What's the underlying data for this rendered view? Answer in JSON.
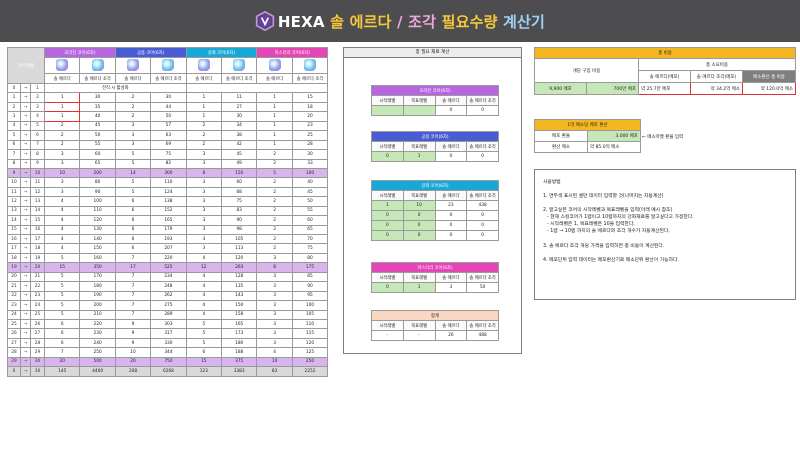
{
  "header": {
    "brand": "HEXA",
    "t1": "솔 에르다",
    "t2": "/",
    "t3": "조각",
    "t4": "필요수량",
    "t5": "계산기"
  },
  "main": {
    "level_header": "코어레벨",
    "cores": [
      {
        "name": "오리진 코어(6차)",
        "color": "#b866e0"
      },
      {
        "name": "공용 코어(6차)",
        "color": "#4a5bd6"
      },
      {
        "name": "강화 코어(6차)",
        "color": "#17a8d8"
      },
      {
        "name": "마스터리 코어(6차)",
        "color": "#e546b5"
      }
    ],
    "sub_erda": "솔 에르다",
    "sub_piece": "솔 에르다 조각",
    "row0_note": "전직 시 활성화",
    "rows": [
      {
        "a": "0",
        "b": "1",
        "v": []
      },
      {
        "a": "1",
        "b": "2",
        "v": [
          "1",
          "30",
          "2",
          "30",
          "1",
          "11",
          "1",
          "15"
        ]
      },
      {
        "a": "2",
        "b": "3",
        "v": [
          "1",
          "35",
          "2",
          "44",
          "1",
          "27",
          "1",
          "18"
        ]
      },
      {
        "a": "3",
        "b": "4",
        "v": [
          "1",
          "40",
          "2",
          "50",
          "1",
          "30",
          "1",
          "20"
        ]
      },
      {
        "a": "4",
        "b": "5",
        "v": [
          "2",
          "45",
          "3",
          "57",
          "2",
          "34",
          "1",
          "23"
        ]
      },
      {
        "a": "5",
        "b": "6",
        "v": [
          "2",
          "50",
          "3",
          "63",
          "2",
          "38",
          "1",
          "25"
        ]
      },
      {
        "a": "6",
        "b": "7",
        "v": [
          "2",
          "55",
          "3",
          "69",
          "2",
          "42",
          "1",
          "28"
        ]
      },
      {
        "a": "7",
        "b": "8",
        "v": [
          "3",
          "60",
          "5",
          "75",
          "3",
          "45",
          "2",
          "30"
        ]
      },
      {
        "a": "8",
        "b": "9",
        "v": [
          "3",
          "65",
          "5",
          "82",
          "3",
          "49",
          "2",
          "33"
        ]
      },
      {
        "a": "9",
        "b": "10",
        "v": [
          "10",
          "200",
          "14",
          "300",
          "8",
          "150",
          "5",
          "100"
        ]
      },
      {
        "a": "10",
        "b": "11",
        "v": [
          "3",
          "80",
          "5",
          "110",
          "3",
          "60",
          "2",
          "40"
        ]
      },
      {
        "a": "11",
        "b": "12",
        "v": [
          "3",
          "90",
          "5",
          "124",
          "3",
          "68",
          "2",
          "45"
        ]
      },
      {
        "a": "12",
        "b": "13",
        "v": [
          "4",
          "100",
          "6",
          "138",
          "3",
          "75",
          "2",
          "50"
        ]
      },
      {
        "a": "13",
        "b": "14",
        "v": [
          "4",
          "110",
          "6",
          "152",
          "3",
          "83",
          "2",
          "55"
        ]
      },
      {
        "a": "14",
        "b": "15",
        "v": [
          "4",
          "120",
          "6",
          "165",
          "3",
          "90",
          "2",
          "60"
        ]
      },
      {
        "a": "15",
        "b": "16",
        "v": [
          "4",
          "130",
          "6",
          "179",
          "3",
          "98",
          "2",
          "65"
        ]
      },
      {
        "a": "16",
        "b": "17",
        "v": [
          "4",
          "140",
          "6",
          "193",
          "3",
          "105",
          "2",
          "70"
        ]
      },
      {
        "a": "17",
        "b": "18",
        "v": [
          "4",
          "150",
          "6",
          "207",
          "3",
          "113",
          "2",
          "75"
        ]
      },
      {
        "a": "18",
        "b": "19",
        "v": [
          "5",
          "160",
          "7",
          "220",
          "4",
          "120",
          "3",
          "80"
        ]
      },
      {
        "a": "19",
        "b": "20",
        "v": [
          "15",
          "350",
          "17",
          "525",
          "12",
          "263",
          "8",
          "175"
        ]
      },
      {
        "a": "20",
        "b": "21",
        "v": [
          "5",
          "170",
          "7",
          "234",
          "4",
          "128",
          "3",
          "85"
        ]
      },
      {
        "a": "21",
        "b": "22",
        "v": [
          "5",
          "180",
          "7",
          "248",
          "4",
          "135",
          "3",
          "90"
        ]
      },
      {
        "a": "22",
        "b": "23",
        "v": [
          "5",
          "190",
          "7",
          "262",
          "4",
          "143",
          "3",
          "95"
        ]
      },
      {
        "a": "23",
        "b": "24",
        "v": [
          "5",
          "200",
          "7",
          "275",
          "4",
          "150",
          "3",
          "100"
        ]
      },
      {
        "a": "24",
        "b": "25",
        "v": [
          "5",
          "210",
          "7",
          "289",
          "4",
          "158",
          "3",
          "105"
        ]
      },
      {
        "a": "25",
        "b": "26",
        "v": [
          "6",
          "220",
          "9",
          "303",
          "5",
          "165",
          "3",
          "110"
        ]
      },
      {
        "a": "26",
        "b": "27",
        "v": [
          "6",
          "230",
          "9",
          "317",
          "5",
          "173",
          "3",
          "115"
        ]
      },
      {
        "a": "27",
        "b": "28",
        "v": [
          "6",
          "240",
          "9",
          "330",
          "5",
          "180",
          "3",
          "120"
        ]
      },
      {
        "a": "28",
        "b": "29",
        "v": [
          "7",
          "250",
          "10",
          "344",
          "6",
          "188",
          "4",
          "125"
        ]
      },
      {
        "a": "29",
        "b": "30",
        "v": [
          "20",
          "500",
          "20",
          "750",
          "15",
          "375",
          "10",
          "250"
        ]
      }
    ],
    "total": {
      "a": "0",
      "b": "30",
      "v": [
        "145",
        "4400",
        "208",
        "6268",
        "123",
        "3383",
        "83",
        "2252"
      ]
    },
    "arrow": "→"
  },
  "mid": {
    "title": "총 필요 재료 계산",
    "cols": [
      "시작레벨",
      "목표레벨",
      "솔 에르다",
      "솔 에르다 조각"
    ],
    "sections": [
      {
        "name": "오리진 코어(6차)",
        "color": "#b866e0",
        "v": [
          "",
          "",
          "0",
          "0"
        ]
      },
      {
        "name": "공용 코어(6차)",
        "color": "#4a5bd6",
        "v": [
          "0",
          "1",
          "0",
          "0"
        ]
      },
      {
        "name": "강화 코어(6차)",
        "color": "#17a8d8",
        "rows": [
          [
            "1",
            "10",
            "23",
            "438"
          ],
          [
            "0",
            "0",
            "0",
            "0"
          ],
          [
            "0",
            "0",
            "0",
            "0"
          ],
          [
            "0",
            "0",
            "0",
            "0"
          ]
        ]
      },
      {
        "name": "마스터리 코어(6차)",
        "color": "#e546b5",
        "v": [
          "0",
          "1",
          "3",
          "50"
        ]
      }
    ],
    "sum_title": "합계",
    "sum_cols": [
      "시작레벨",
      "목표레벨",
      "솔 에르다",
      "솔 에르다 조각"
    ],
    "sum_v": [
      "-",
      "-",
      "26",
      "488"
    ]
  },
  "cost": {
    "title": "총 비용",
    "left_head": "개당 구입 비용",
    "right_head": "총 소요비용",
    "c1": "솔 에르다(메포)",
    "c2": "솔 에르다 조각(메포)",
    "c3": "메소환산 총 비용",
    "unit_erda": "9,900 메포",
    "unit_piece": "700만 메포",
    "sum1": "약 25.7만 메포",
    "sum2": "약 34.2억 메소",
    "sum3": "약 120.0억 메소"
  },
  "exchange": {
    "title": "1억 메소당 메포 환산",
    "l1": "메포 환율",
    "v1": "3,000 메포",
    "note": "← 메소마켓 환율 입력",
    "l2": "환산 메소",
    "v2": "약 85.0억 메소"
  },
  "help": {
    "title": "사용방법",
    "l1": "1. 연두색 표시된 셀만 데이터 입력할 것(나머지는 자동계산)",
    "l2": "2. 알고싶은 코어의 시작레벨과 목표레벨을 입력(아래 예시 참조)",
    "l3": "- 현재 스킬코어가 1렙이고 10렙까지의 강화재료를 알고싶다고 가정한다.",
    "l4": "- 시작레벨은 1, 목표레벨은 10을 입력한다.",
    "l5": "- 1렙 → 10렙 까지의 솔 에르다와 조각 개수가 자동계산된다.",
    "l6": "3. 솔 에르다 조각 개당 가격을 입력하면 총 비용이 계산된다.",
    "l7": "4. 메포단위 입력 데이터는 메포환산기로 메소단위 환산이 가능하다."
  }
}
